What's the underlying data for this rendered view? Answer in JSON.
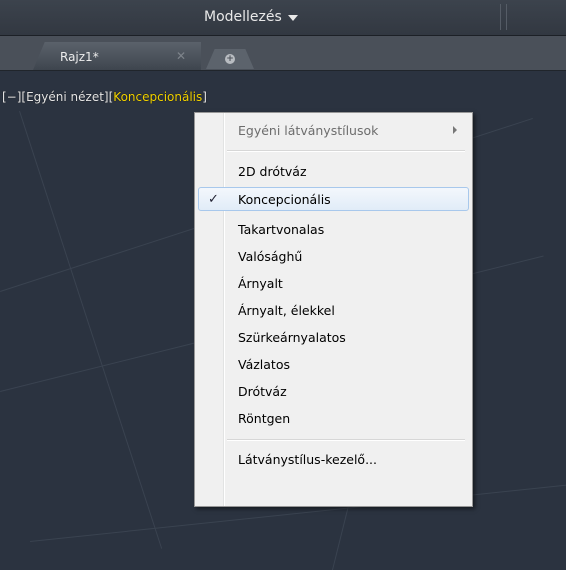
{
  "workspace": {
    "label": "Modellezés"
  },
  "tabs": {
    "drawing_tab": "Rajz1*",
    "close_glyph": "✕",
    "new_tab_glyph": "+"
  },
  "viewport": {
    "control_minus": "[−]",
    "view": "[Egyéni nézet]",
    "style_open": "[",
    "style": "Koncepcionális",
    "style_close": "]"
  },
  "menu": {
    "custom_styles": "Egyéni látványstílusok",
    "items": [
      "2D drótváz",
      "Koncepcionális",
      "Takartvonalas",
      "Valósághű",
      "Árnyalt",
      "Árnyalt, élekkel",
      "Szürkeárnyalatos",
      "Vázlatos",
      "Drótváz",
      "Röntgen"
    ],
    "selected_check": "✓",
    "manager": "Látványstílus-kezelő..."
  },
  "colors": {
    "highlight": "#f2d200",
    "canvas": "#2b3340"
  }
}
